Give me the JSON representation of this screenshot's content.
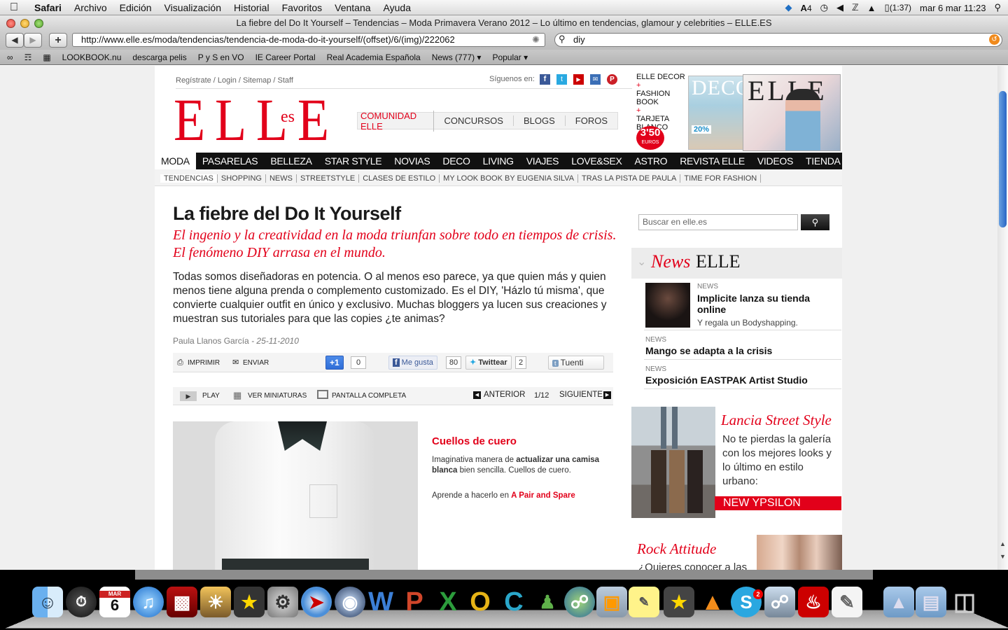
{
  "menubar": {
    "items": [
      "Safari",
      "Archivo",
      "Edición",
      "Visualización",
      "Historial",
      "Favoritos",
      "Ventana",
      "Ayuda"
    ],
    "status": {
      "mail_count": "4",
      "battery": "(1:37)",
      "datetime": "mar 6 mar  11:23"
    }
  },
  "window": {
    "title": "La fiebre del Do It Yourself – Tendencias – Moda Primavera Verano 2012 – Lo último en tendencias, glamour y celebrities – ELLE.ES"
  },
  "toolbar": {
    "url": "http://www.elle.es/moda/tendencias/tendencia-de-moda-do-it-yourself/(offset)/6/(img)/222062",
    "search_value": "diy",
    "plus_label": "+"
  },
  "bookmarks": [
    "LOOKBOOK.nu",
    "descarga pelis",
    "P y S en VO",
    "IE Career Portal",
    "Real Academia Española",
    "News (777) ▾",
    "Popular ▾"
  ],
  "site": {
    "top_links": "Regístrate / Login / Sitemap / Staff",
    "follow_label": "Síguenos en:",
    "logo": "ELLE",
    "logo_suffix": "es",
    "community_tabs": [
      "COMUNIDAD ELLE",
      "CONCURSOS",
      "BLOGS",
      "FOROS"
    ],
    "promo": {
      "lines": [
        "ELLE DECOR",
        "+",
        "FASHION",
        "BOOK",
        "+",
        "TARJETA",
        "BLANCO"
      ],
      "price": "3'50",
      "price_unit": "EUROS",
      "cover1": "DECO",
      "cover2": "ELLE",
      "badge": "20%"
    },
    "main_nav": [
      "MODA",
      "PASARELAS",
      "BELLEZA",
      "STAR STYLE",
      "NOVIAS",
      "DECO",
      "LIVING",
      "VIAJES",
      "LOVE&SEX",
      "ASTRO",
      "REVISTA ELLE",
      "VIDEOS",
      "TIENDA ELLE"
    ],
    "sub_nav": [
      "TENDENCIAS",
      "SHOPPING",
      "NEWS",
      "STREETSTYLE",
      "CLASES DE ESTILO",
      "MY LOOK BOOK BY EUGENIA SILVA",
      "TRAS LA PISTA DE PAULA",
      "TIME FOR FASHION"
    ]
  },
  "article": {
    "title": "La fiebre del Do It Yourself",
    "subtitle": "El ingenio y la creatividad en la moda triunfan sobre todo en tiempos de crisis. El fenómeno DIY arrasa en el mundo.",
    "body": "Todas somos diseñadoras en potencia. O al menos eso parece, ya que quien más y quien menos tiene alguna prenda o complemento customizado. Es el DIY, 'Házlo tú misma', que convierte cualquier outfit en único y exclusivo. Muchas bloggers ya lucen sus creaciones y muestran sus tutoriales para que las copies ¿te animas?",
    "author": "Paula Llanos García",
    "date": "- 25-11-2010",
    "actions": {
      "print": "IMPRIMIR",
      "send": "ENVIAR",
      "gplus": "+1",
      "gplus_count": "0",
      "like": "Me gusta",
      "like_count": "80",
      "tweet": "Twittear",
      "tweet_count": "2",
      "tuenti": "Tuenti"
    },
    "gallery": {
      "play": "PLAY",
      "thumbs": "VER MINIATURAS",
      "fullscreen": "PANTALLA COMPLETA",
      "prev": "ANTERIOR",
      "counter": "1/12",
      "next": "SIGUIENTE"
    },
    "slide": {
      "title": "Cuellos de cuero",
      "desc_pre": "Imaginativa manera de ",
      "desc_bold": "actualizar una camisa blanca",
      "desc_post": " bien sencilla. Cuellos de cuero.",
      "learn_pre": "Aprende a hacerlo en ",
      "learn_link": "A Pair and Spare"
    }
  },
  "sidebar": {
    "search_placeholder": "Buscar en elle.es",
    "news_title_red": "News",
    "news_title_black": "ELLE",
    "news": [
      {
        "tag": "NEWS",
        "title": "Implicite lanza su tienda online",
        "desc": "Y regala un Bodyshapping."
      },
      {
        "tag": "NEWS",
        "title": "Mango se adapta a la crisis",
        "desc": ""
      },
      {
        "tag": "NEWS",
        "title": "Exposición EASTPAK Artist Studio",
        "desc": ""
      }
    ],
    "street": {
      "title": "Lancia Street Style",
      "text": "No te pierdas la galería con los mejores looks y lo último en estilo urbano:",
      "button": "NEW YPSILON"
    },
    "rock": {
      "title": "Rock Attitude",
      "text": "¿Quieres conocer a las"
    }
  },
  "dock": {
    "calendar_day": "6",
    "calendar_month": "MAR",
    "skype_badge": "2",
    "letters": [
      "W",
      "P",
      "X",
      "O",
      "C"
    ]
  }
}
